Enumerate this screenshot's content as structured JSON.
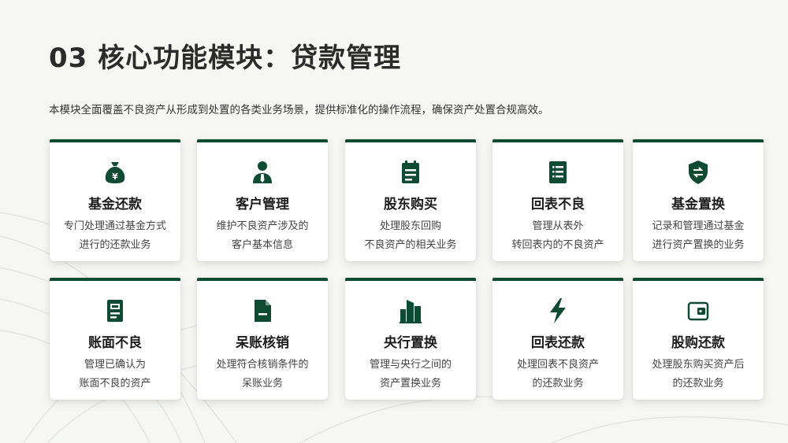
{
  "header": {
    "title": "03 核心功能模块：贷款管理",
    "subtitle": "本模块全面覆盖不良资产从形成到处置的各类业务场景，提供标准化的操作流程，确保资产处置合规高效。"
  },
  "colors": {
    "accent": "#0f4a32",
    "background": "#f6f6f3",
    "card": "#ffffff"
  },
  "cards": [
    {
      "icon": "money-bag-icon",
      "title": "基金还款",
      "desc": [
        "专门处理通过基金方式",
        "进行的还款业务"
      ]
    },
    {
      "icon": "user-icon",
      "title": "客户管理",
      "desc": [
        "维护不良资产涉及的",
        "客户基本信息"
      ]
    },
    {
      "icon": "calendar-icon",
      "title": "股东购买",
      "desc": [
        "处理股东回购",
        "不良资产的相关业务"
      ]
    },
    {
      "icon": "document-list-icon",
      "title": "回表不良",
      "desc": [
        "管理从表外",
        "转回表内的不良资产"
      ]
    },
    {
      "icon": "shield-exchange-icon",
      "title": "基金置换",
      "desc": [
        "记录和管理通过基金",
        "进行资产置换的业务"
      ]
    },
    {
      "icon": "ledger-icon",
      "title": "账面不良",
      "desc": [
        "管理已确认为",
        "账面不良的资产"
      ]
    },
    {
      "icon": "file-minus-icon",
      "title": "呆账核销",
      "desc": [
        "处理符合核销条件的",
        "呆账业务"
      ]
    },
    {
      "icon": "building-icon",
      "title": "央行置换",
      "desc": [
        "管理与央行之间的",
        "资产置换业务"
      ]
    },
    {
      "icon": "lightning-icon",
      "title": "回表还款",
      "desc": [
        "处理回表不良资产",
        "的还款业务"
      ]
    },
    {
      "icon": "wallet-icon",
      "title": "股购还款",
      "desc": [
        "处理股东购买资产后",
        "的还款业务"
      ]
    }
  ]
}
